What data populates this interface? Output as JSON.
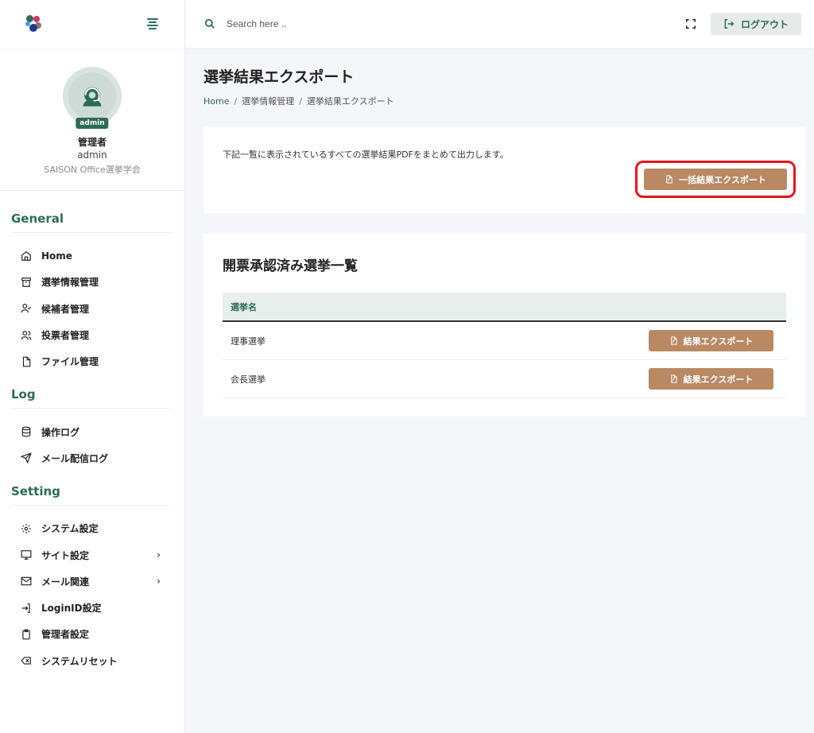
{
  "header": {
    "search_placeholder": "Search here ..",
    "logout_label": "ログアウト"
  },
  "profile": {
    "badge": "admin",
    "role": "管理者",
    "username": "admin",
    "organization": "SAISON Office選挙学会"
  },
  "sidebar": {
    "sections": [
      {
        "title": "General",
        "items": [
          {
            "label": "Home",
            "icon": "home-icon"
          },
          {
            "label": "選挙情報管理",
            "icon": "archive-icon"
          },
          {
            "label": "候補者管理",
            "icon": "user-check-icon"
          },
          {
            "label": "投票者管理",
            "icon": "users-icon"
          },
          {
            "label": "ファイル管理",
            "icon": "file-icon"
          }
        ]
      },
      {
        "title": "Log",
        "items": [
          {
            "label": "操作ログ",
            "icon": "database-icon"
          },
          {
            "label": "メール配信ログ",
            "icon": "send-icon"
          }
        ]
      },
      {
        "title": "Setting",
        "items": [
          {
            "label": "システム設定",
            "icon": "gear-icon"
          },
          {
            "label": "サイト設定",
            "icon": "monitor-icon",
            "chevron": "›"
          },
          {
            "label": "メール関連",
            "icon": "mail-icon",
            "chevron": "›"
          },
          {
            "label": "LoginID設定",
            "icon": "login-icon"
          },
          {
            "label": "管理者設定",
            "icon": "clipboard-icon"
          },
          {
            "label": "システムリセット",
            "icon": "delete-icon"
          }
        ]
      }
    ]
  },
  "page": {
    "title": "選挙結果エクスポート",
    "breadcrumb": [
      "Home",
      "選挙情報管理",
      "選挙結果エクスポート"
    ],
    "breadcrumb_sep": "/"
  },
  "export_card": {
    "description": "下記一覧に表示されているすべての選挙結果PDFをまとめて出力します。",
    "button_label": "一括結果エクスポート"
  },
  "list_card": {
    "title": "開票承認済み選挙一覧",
    "column_header": "選挙名",
    "rows": [
      {
        "name": "理事選挙",
        "button": "結果エクスポート"
      },
      {
        "name": "会長選挙",
        "button": "結果エクスポート"
      }
    ]
  },
  "colors": {
    "accent": "#2e6a5a",
    "button": "#b98963",
    "highlight": "#e8141b"
  }
}
